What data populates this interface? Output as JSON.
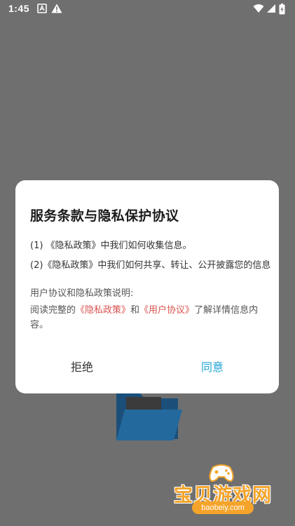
{
  "status_bar": {
    "time": "1:45",
    "icons": [
      "a-badge-icon",
      "alert-icon",
      "wifi-icon",
      "signal-icon",
      "battery-icon"
    ]
  },
  "dialog": {
    "title": "服务条款与隐私保护协议",
    "clause_1": "(1) 《隐私政策》中我们如何收集信息。",
    "clause_2": "(2)《隐私政策》中我们如何共享、转让、公开披露您的信息",
    "note_label": "用户协议和隐私政策说明:",
    "note_prefix": "阅读完整的",
    "privacy_link": "《隐私政策》",
    "note_and": "和",
    "user_link": "《用户协议》",
    "note_suffix": "了解详情信息内容。",
    "reject_label": "拒绝",
    "agree_label": "同意"
  },
  "watermark": {
    "text": "宝贝游戏网",
    "url": "baobeiy.com"
  },
  "colors": {
    "overlay": "#6f6f6f",
    "link": "#d9534f",
    "agree": "#1fa5d6",
    "watermark": "#f4a42a"
  }
}
